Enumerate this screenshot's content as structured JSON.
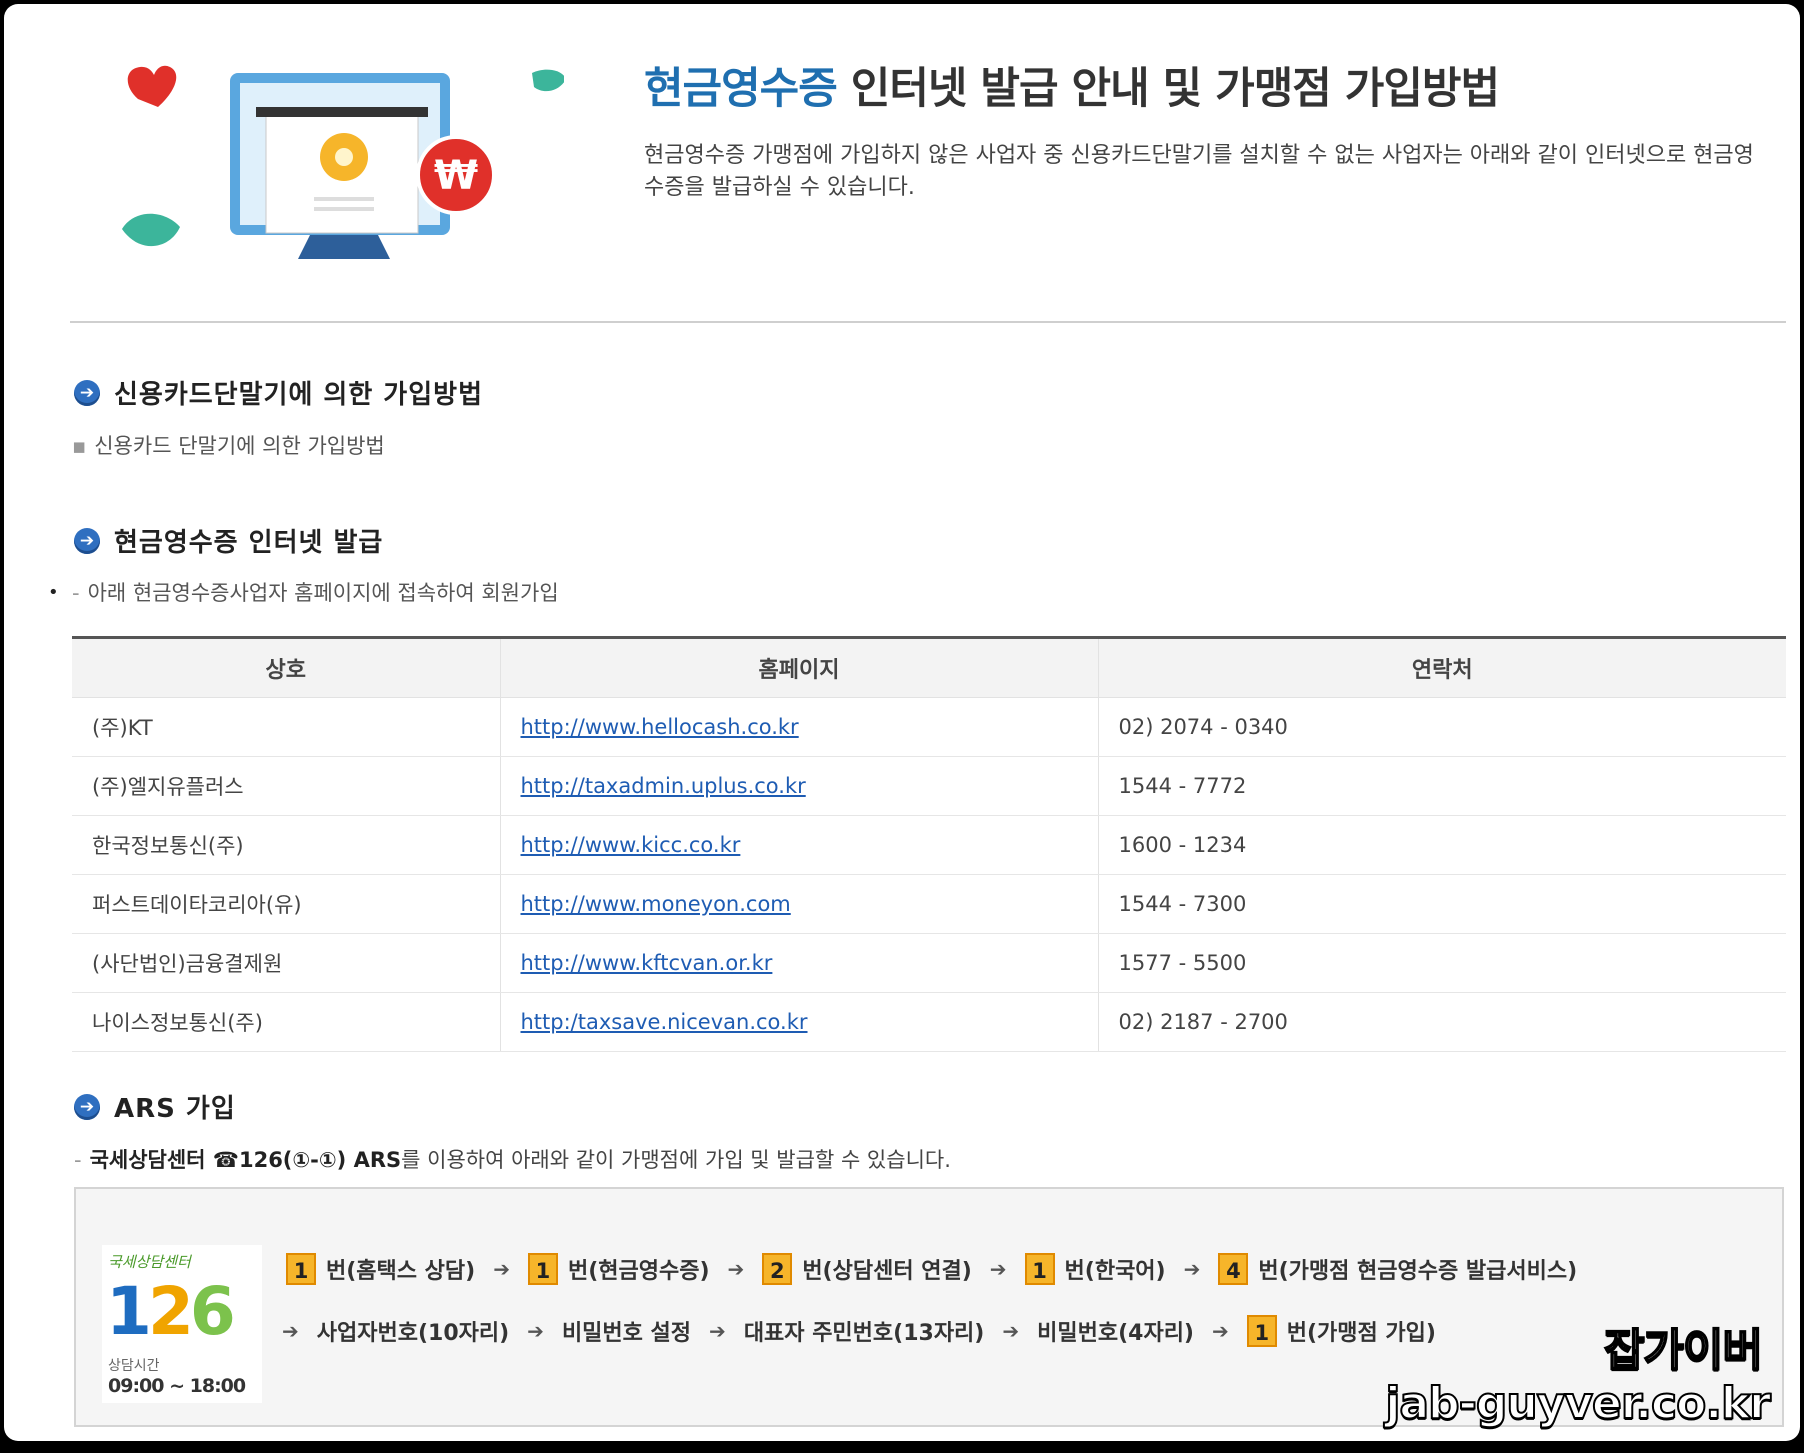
{
  "header": {
    "title_highlight": "현금영수증",
    "title_rest": " 인터넷 발급 안내 및 가맹점 가입방법",
    "intro": "현금영수증 가맹점에 가입하지 않은 사업자 중 신용카드단말기를 설치할 수 없는 사업자는 아래와 같이 인터넷으로 현금영수증을 발급하실 수 있습니다."
  },
  "section1": {
    "heading": "신용카드단말기에 의한 가입방법",
    "sub_mark": "▪",
    "sub": "신용카드 단말기에 의한 가입방법"
  },
  "section2": {
    "heading": "현금영수증 인터넷 발급",
    "bullet": "•",
    "sub_mark": "-",
    "sub": "아래 현금영수증사업자 홈페이지에 접속하여 회원가입"
  },
  "table": {
    "headers": [
      "상호",
      "홈페이지",
      "연락처"
    ],
    "rows": [
      {
        "name": "(주)KT",
        "url": "http://www.hellocash.co.kr",
        "phone": "02) 2074 - 0340"
      },
      {
        "name": "(주)엘지유플러스",
        "url": "http://taxadmin.uplus.co.kr",
        "phone": "1544 - 7772"
      },
      {
        "name": "한국정보통신(주)",
        "url": "http://www.kicc.co.kr",
        "phone": "1600 - 1234"
      },
      {
        "name": "퍼스트데이타코리아(유)",
        "url": "http://www.moneyon.com",
        "phone": "1544 - 7300"
      },
      {
        "name": "(사단법인)금융결제원",
        "url": "http://www.kftcvan.or.kr",
        "phone": "1577 - 5500"
      },
      {
        "name": "나이스정보통신(주)",
        "url": "http:/taxsave.nicevan.co.kr",
        "phone": "02) 2187 - 2700"
      }
    ]
  },
  "section3": {
    "heading": "ARS 가입",
    "sub_mark": "-",
    "desc_bold": "국세상담센터 ☎126(①-①) ARS",
    "desc_rest": "를 이용하여 아래와 같이 가맹점에 가입 및 발급할 수 있습니다."
  },
  "ars": {
    "logo_top": "국세상담센터",
    "logo_num1": "1",
    "logo_num2": "2",
    "logo_num3": "6",
    "hours_label": "상담시간",
    "hours": "09:00 ~ 18:00",
    "row1": [
      {
        "num": "1",
        "label": "번(홈택스 상담)"
      },
      {
        "num": "1",
        "label": "번(현금영수증)"
      },
      {
        "num": "2",
        "label": "번(상담센터 연결)"
      },
      {
        "num": "1",
        "label": "번(한국어)"
      },
      {
        "num": "4",
        "label": "번(가맹점 현금영수증 발급서비스)"
      }
    ],
    "row2": [
      {
        "label": "사업자번호(10자리)"
      },
      {
        "label": "비밀번호 설정"
      },
      {
        "label": "대표자 주민번호(13자리)"
      },
      {
        "label": "비밀번호(4자리)"
      },
      {
        "num": "1",
        "label": "번(가맹점 가입)"
      }
    ],
    "arrow": "➔"
  },
  "watermark": {
    "name": "잡가이버",
    "url": "jab-guyver.co.kr"
  },
  "colors": {
    "title_accent": "#1f6fb0",
    "section_bullet": "#2f6fc0",
    "step_box": "#f6b52a",
    "link": "#1e5cb3"
  }
}
